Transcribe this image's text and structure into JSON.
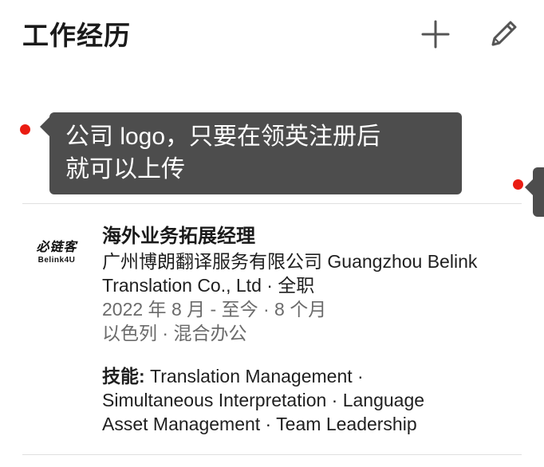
{
  "header": {
    "title": "工作经历",
    "add_icon": "plus-icon",
    "edit_icon": "pencil-icon"
  },
  "tooltip": {
    "line1": "公司 logo，只要在领英注册后",
    "line2": "就可以上传"
  },
  "experience": {
    "logo": {
      "cn": "必链客",
      "en": "Belink4U"
    },
    "title": "海外业务拓展经理",
    "company_line1": "广州博朗翻译服务有限公司 Guangzhou Belink",
    "company_line2": "Translation Co., Ltd · 全职",
    "dates": "2022 年 8 月 - 至今 · 8 个月",
    "location": "以色列 · 混合办公",
    "skills_label": "技能:",
    "skills_line1": " Translation Management ·",
    "skills_line2": "Simultaneous Interpretation · Language",
    "skills_line3": "Asset Management · Team Leadership"
  },
  "colors": {
    "dot": "#ea1c12",
    "tooltip_bg": "#4d4d4d",
    "muted_text": "#6b6b6b"
  }
}
